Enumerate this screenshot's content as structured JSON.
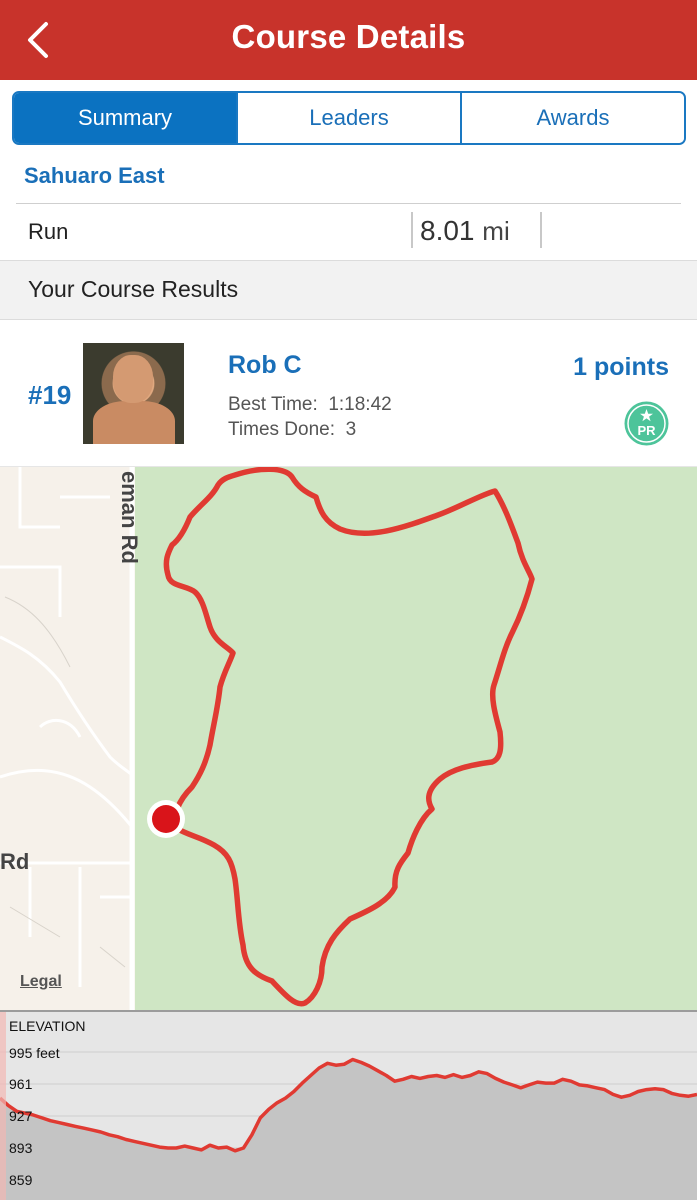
{
  "header": {
    "title": "Course Details",
    "back_icon": "chevron-left-icon"
  },
  "tabs": [
    {
      "label": "Summary",
      "active": true
    },
    {
      "label": "Leaders",
      "active": false
    },
    {
      "label": "Awards",
      "active": false
    }
  ],
  "course": {
    "name": "Sahuaro East",
    "activity": "Run",
    "distance_value": "8.01",
    "distance_unit": "mi"
  },
  "results": {
    "heading": "Your Course Results",
    "rank": "#19",
    "user_name": "Rob C",
    "best_time_label": "Best Time:",
    "best_time": "1:18:42",
    "times_done_label": "Times Done:",
    "times_done": "3",
    "points": "1 points",
    "badge_text": "PR"
  },
  "map": {
    "road_label_1": "eman Rd",
    "road_label_2": "Rd",
    "legal_link": "Legal"
  },
  "elevation": {
    "title": "ELEVATION",
    "max_label": "995 feet",
    "ticks": [
      "961",
      "927",
      "893",
      "859"
    ],
    "profile": [
      946,
      938,
      932,
      930,
      928,
      925,
      922,
      920,
      918,
      916,
      914,
      912,
      910,
      907,
      905,
      902,
      900,
      898,
      896,
      894,
      893,
      893,
      895,
      893,
      891,
      896,
      893,
      894,
      890,
      893,
      907,
      925,
      934,
      941,
      946,
      953,
      962,
      970,
      978,
      983,
      981,
      982,
      987,
      984,
      980,
      975,
      970,
      964,
      966,
      969,
      967,
      969,
      970,
      968,
      971,
      968,
      970,
      974,
      972,
      967,
      963,
      960,
      957,
      960,
      963,
      962,
      962,
      966,
      964,
      960,
      959,
      957,
      955,
      950,
      947,
      949,
      953,
      955,
      956,
      955,
      951,
      949,
      948,
      950
    ],
    "colors": {
      "line": "#e03a32",
      "fill": "#c4c4c4"
    }
  }
}
